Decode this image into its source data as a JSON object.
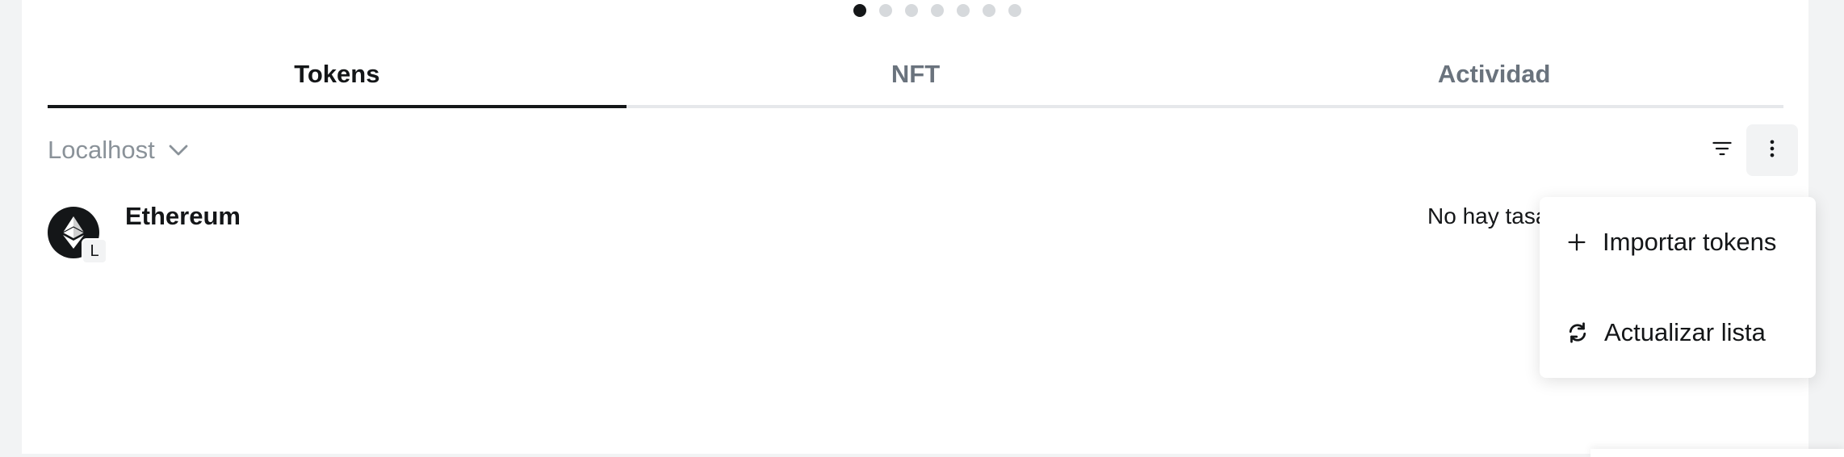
{
  "carousel": {
    "count": 7,
    "active_index": 0
  },
  "tabs": [
    {
      "label": "Tokens",
      "active": true
    },
    {
      "label": "NFT",
      "active": false
    },
    {
      "label": "Actividad",
      "active": false
    }
  ],
  "network": {
    "label": "Localhost",
    "icon": "chevron-down-icon"
  },
  "toolbar": {
    "filter_icon": "filter-icon",
    "more_icon": "more-vertical-icon"
  },
  "tokens": [
    {
      "name": "Ethereum",
      "badge": "L",
      "rate": "No hay tasa",
      "icon": "ethereum-icon"
    }
  ],
  "menu": {
    "items": [
      {
        "label": "Importar tokens",
        "icon": "plus-icon"
      },
      {
        "label": "Actualizar lista",
        "icon": "refresh-icon"
      }
    ]
  },
  "colors": {
    "text_primary": "#141618",
    "text_muted": "#6a737d",
    "background": "#f2f3f4",
    "border": "#e6e8eb"
  }
}
